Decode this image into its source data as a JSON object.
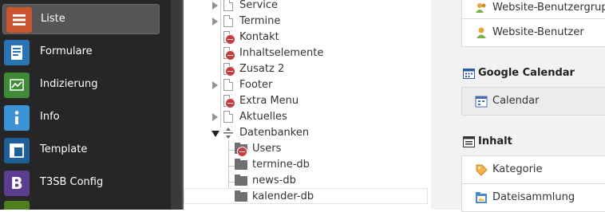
{
  "modules": [
    {
      "label": "Liste",
      "icon": "list-icon",
      "color": "#c9562e",
      "active": true
    },
    {
      "label": "Formulare",
      "icon": "form-icon",
      "color": "#2a74b5"
    },
    {
      "label": "Indizierung",
      "icon": "chart-icon",
      "color": "#3f8a37"
    },
    {
      "label": "Info",
      "icon": "info-icon",
      "color": "#3c94d6"
    },
    {
      "label": "Template",
      "icon": "template-icon",
      "color": "#1f5f97"
    },
    {
      "label": "T3SB Config",
      "icon": "bootstrap-icon",
      "color": "#5b3e8f"
    }
  ],
  "tree": {
    "nodes": [
      {
        "label": "Service",
        "icon": "page-icon",
        "expandable": true
      },
      {
        "label": "Termine",
        "icon": "page-icon",
        "expandable": true
      },
      {
        "label": "Kontakt",
        "icon": "page-hidden-icon"
      },
      {
        "label": "Inhaltselemente",
        "icon": "page-hidden-icon"
      },
      {
        "label": "Zusatz 2",
        "icon": "page-hidden-icon"
      },
      {
        "label": "Footer",
        "icon": "page-icon",
        "expandable": true
      },
      {
        "label": "Extra Menu",
        "icon": "page-hidden-icon"
      },
      {
        "label": "Aktuelles",
        "icon": "page-icon",
        "expandable": true
      },
      {
        "label": "Datenbanken",
        "icon": "separator-icon",
        "expanded": true
      },
      {
        "label": "Users",
        "icon": "folder-hidden-icon"
      },
      {
        "label": "termine-db",
        "icon": "folder-icon"
      },
      {
        "label": "news-db",
        "icon": "folder-icon"
      },
      {
        "label": "kalender-db",
        "icon": "folder-icon",
        "selected": true
      }
    ]
  },
  "right": {
    "cards_top": [
      {
        "label": "Website-Benutzergrupp",
        "icon": "usergroup-icon"
      },
      {
        "label": "Website-Benutzer",
        "icon": "user-icon"
      }
    ],
    "sections": [
      {
        "title": "Google Calendar",
        "icon": "calendar-icon",
        "items": [
          {
            "label": "Calendar",
            "icon": "calendar-item-icon"
          }
        ]
      },
      {
        "title": "Inhalt",
        "icon": "content-icon",
        "items": [
          {
            "label": "Kategorie",
            "icon": "tag-icon"
          },
          {
            "label": "Dateisammlung",
            "icon": "file-collection-icon"
          }
        ]
      }
    ]
  }
}
